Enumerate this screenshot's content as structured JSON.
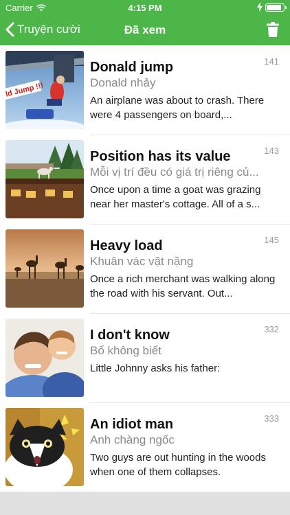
{
  "status_bar": {
    "carrier": "Carrier",
    "time": "4:15 PM"
  },
  "nav": {
    "back_label": "Truyện cười",
    "title": "Đã xem"
  },
  "colors": {
    "accent": "#4cb649",
    "background": "#ffffff",
    "secondary_text": "#8a8a8a"
  },
  "items": [
    {
      "title": "Donald jump",
      "subtitle": "Donald nhảy",
      "description": "An airplane was about to crash. There were 4 passengers on board,...",
      "count": "141",
      "thumb_caption": "ld Jump !!!"
    },
    {
      "title": "Position has its value",
      "subtitle": "Mỗi vị trí đều có giá trị riêng củ...",
      "description": "Once upon a time a goat was grazing near her master's cottage. All of a s...",
      "count": "143"
    },
    {
      "title": "Heavy load",
      "subtitle": "Khuân vác vật nặng",
      "description": "Once a rich merchant was walking along the road with his servant. Out...",
      "count": "145"
    },
    {
      "title": "I don't know",
      "subtitle": "Bố không biết",
      "description": "Little Johnny asks his father:",
      "count": "332"
    },
    {
      "title": "An idiot man",
      "subtitle": "Anh chàng ngốc",
      "description": "Two guys are out hunting in the woods when one of them collapses.",
      "count": "333"
    }
  ]
}
